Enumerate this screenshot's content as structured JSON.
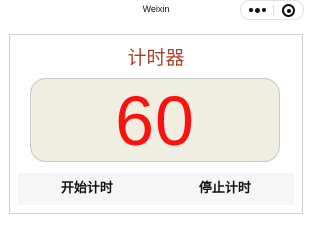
{
  "navbar": {
    "title": "Weixin",
    "more_icon": "more-dots-icon",
    "close_icon": "mini-program-close-icon"
  },
  "timer": {
    "title": "计时器",
    "value": "60",
    "start_label": "开始计时",
    "stop_label": "停止计时"
  },
  "colors": {
    "title": "#b0432c",
    "value": "#ff1010",
    "display_bg": "#efeee0",
    "button_bg": "#f6f6f6"
  }
}
